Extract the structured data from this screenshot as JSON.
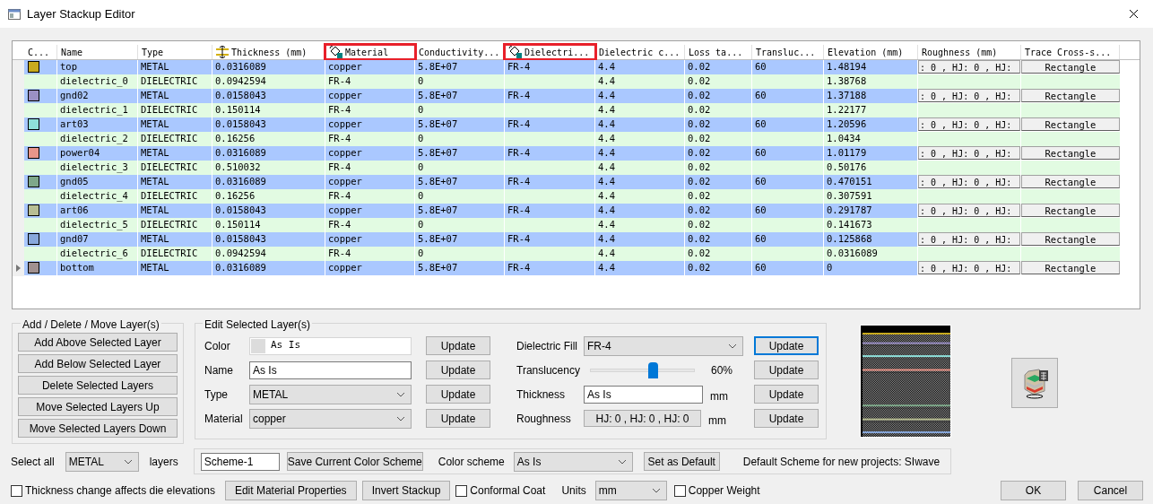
{
  "window": {
    "title": "Layer Stackup Editor"
  },
  "table": {
    "columns": [
      {
        "label": "C...",
        "highlighted": false
      },
      {
        "label": "Name",
        "highlighted": false
      },
      {
        "label": "Type",
        "highlighted": false
      },
      {
        "label": "Thickness (mm)",
        "highlighted": false
      },
      {
        "label": "Material",
        "highlighted": true
      },
      {
        "label": "Conductivity...",
        "highlighted": false
      },
      {
        "label": "Dielectri...",
        "highlighted": true
      },
      {
        "label": "Dielectric c...",
        "highlighted": false
      },
      {
        "label": "Loss ta...",
        "highlighted": false
      },
      {
        "label": "Transluc...",
        "highlighted": false
      },
      {
        "label": "Elevation (mm)",
        "highlighted": false
      },
      {
        "label": "Roughness (mm)",
        "highlighted": false
      },
      {
        "label": "Trace Cross-s...",
        "highlighted": false
      }
    ],
    "rows": [
      {
        "kind": "metal",
        "current": false,
        "color": "#c8aa1e",
        "name": "top",
        "type": "METAL",
        "thickness": "0.0316089",
        "material": "copper",
        "conductivity": "5.8E+07",
        "dielectric_fill": "FR-4",
        "dielectric_constant": "4.4",
        "loss_tangent": "0.02",
        "translucency": "60",
        "elevation": "1.48194",
        "roughness": ": 0 , HJ: 0 , HJ:",
        "trace_cross_section": "Rectangle"
      },
      {
        "kind": "dielectric",
        "current": false,
        "name": "dielectric_0",
        "type": "DIELECTRIC",
        "thickness": "0.0942594",
        "material": "FR-4",
        "conductivity": "0",
        "dielectric_constant": "4.4",
        "loss_tangent": "0.02",
        "elevation": "1.38768"
      },
      {
        "kind": "metal",
        "current": false,
        "color": "#9b90c4",
        "name": "gnd02",
        "type": "METAL",
        "thickness": "0.0158043",
        "material": "copper",
        "conductivity": "5.8E+07",
        "dielectric_fill": "FR-4",
        "dielectric_constant": "4.4",
        "loss_tangent": "0.02",
        "translucency": "60",
        "elevation": "1.37188",
        "roughness": ": 0 , HJ: 0 , HJ:",
        "trace_cross_section": "Rectangle"
      },
      {
        "kind": "dielectric",
        "current": false,
        "name": "dielectric_1",
        "type": "DIELECTRIC",
        "thickness": "0.150114",
        "material": "FR-4",
        "conductivity": "0",
        "dielectric_constant": "4.4",
        "loss_tangent": "0.02",
        "elevation": "1.22177"
      },
      {
        "kind": "metal",
        "current": false,
        "color": "#8ee0da",
        "name": "art03",
        "type": "METAL",
        "thickness": "0.0158043",
        "material": "copper",
        "conductivity": "5.8E+07",
        "dielectric_fill": "FR-4",
        "dielectric_constant": "4.4",
        "loss_tangent": "0.02",
        "translucency": "60",
        "elevation": "1.20596",
        "roughness": ": 0 , HJ: 0 , HJ:",
        "trace_cross_section": "Rectangle"
      },
      {
        "kind": "dielectric",
        "current": false,
        "name": "dielectric_2",
        "type": "DIELECTRIC",
        "thickness": "0.16256",
        "material": "FR-4",
        "conductivity": "0",
        "dielectric_constant": "4.4",
        "loss_tangent": "0.02",
        "elevation": "1.0434"
      },
      {
        "kind": "metal",
        "current": false,
        "color": "#e8968a",
        "name": "power04",
        "type": "METAL",
        "thickness": "0.0316089",
        "material": "copper",
        "conductivity": "5.8E+07",
        "dielectric_fill": "FR-4",
        "dielectric_constant": "4.4",
        "loss_tangent": "0.02",
        "translucency": "60",
        "elevation": "1.01179",
        "roughness": ": 0 , HJ: 0 , HJ:",
        "trace_cross_section": "Rectangle"
      },
      {
        "kind": "dielectric",
        "current": false,
        "name": "dielectric_3",
        "type": "DIELECTRIC",
        "thickness": "0.510032",
        "material": "FR-4",
        "conductivity": "0",
        "dielectric_constant": "4.4",
        "loss_tangent": "0.02",
        "elevation": "0.50176"
      },
      {
        "kind": "metal",
        "current": false,
        "color": "#7ea88a",
        "name": "gnd05",
        "type": "METAL",
        "thickness": "0.0316089",
        "material": "copper",
        "conductivity": "5.8E+07",
        "dielectric_fill": "FR-4",
        "dielectric_constant": "4.4",
        "loss_tangent": "0.02",
        "translucency": "60",
        "elevation": "0.470151",
        "roughness": ": 0 , HJ: 0 , HJ:",
        "trace_cross_section": "Rectangle"
      },
      {
        "kind": "dielectric",
        "current": false,
        "name": "dielectric_4",
        "type": "DIELECTRIC",
        "thickness": "0.16256",
        "material": "FR-4",
        "conductivity": "0",
        "dielectric_constant": "4.4",
        "loss_tangent": "0.02",
        "elevation": "0.307591"
      },
      {
        "kind": "metal",
        "current": false,
        "color": "#b8be94",
        "name": "art06",
        "type": "METAL",
        "thickness": "0.0158043",
        "material": "copper",
        "conductivity": "5.8E+07",
        "dielectric_fill": "FR-4",
        "dielectric_constant": "4.4",
        "loss_tangent": "0.02",
        "translucency": "60",
        "elevation": "0.291787",
        "roughness": ": 0 , HJ: 0 , HJ:",
        "trace_cross_section": "Rectangle"
      },
      {
        "kind": "dielectric",
        "current": false,
        "name": "dielectric_5",
        "type": "DIELECTRIC",
        "thickness": "0.150114",
        "material": "FR-4",
        "conductivity": "0",
        "dielectric_constant": "4.4",
        "loss_tangent": "0.02",
        "elevation": "0.141673"
      },
      {
        "kind": "metal",
        "current": false,
        "color": "#88a8dc",
        "name": "gnd07",
        "type": "METAL",
        "thickness": "0.0158043",
        "material": "copper",
        "conductivity": "5.8E+07",
        "dielectric_fill": "FR-4",
        "dielectric_constant": "4.4",
        "loss_tangent": "0.02",
        "translucency": "60",
        "elevation": "0.125868",
        "roughness": ": 0 , HJ: 0 , HJ:",
        "trace_cross_section": "Rectangle"
      },
      {
        "kind": "dielectric",
        "current": false,
        "name": "dielectric_6",
        "type": "DIELECTRIC",
        "thickness": "0.0942594",
        "material": "FR-4",
        "conductivity": "0",
        "dielectric_constant": "4.4",
        "loss_tangent": "0.02",
        "elevation": "0.0316089"
      },
      {
        "kind": "metal",
        "current": true,
        "color": "#a09090",
        "name": "bottom",
        "type": "METAL",
        "thickness": "0.0316089",
        "material": "copper",
        "conductivity": "5.8E+07",
        "dielectric_fill": "FR-4",
        "dielectric_constant": "4.4",
        "loss_tangent": "0.02",
        "translucency": "60",
        "elevation": "0",
        "roughness": ": 0 , HJ: 0 , HJ:",
        "trace_cross_section": "Rectangle"
      }
    ]
  },
  "layer_group": {
    "title": "Add / Delete / Move Layer(s)",
    "buttons": [
      "Add Above Selected Layer",
      "Add Below Selected Layer",
      "Delete Selected Layers",
      "Move Selected Layers Up",
      "Move Selected Layers Down"
    ]
  },
  "edit_group": {
    "title": "Edit Selected Layer(s)",
    "left_fields": [
      {
        "kind": "color",
        "label": "Color",
        "value": "As Is",
        "button": "Update",
        "button_focused": false
      },
      {
        "kind": "text",
        "label": "Name",
        "value": "As Is",
        "button": "Update",
        "button_focused": false
      },
      {
        "kind": "dropdown",
        "label": "Type",
        "value": "METAL",
        "button": "Update",
        "button_focused": false
      },
      {
        "kind": "dropdown",
        "label": "Material",
        "value": "copper",
        "button": "Update",
        "button_focused": false
      }
    ],
    "right_fields": [
      {
        "kind": "dropdown",
        "label": "Dielectric Fill",
        "value": "FR-4",
        "button": "Update",
        "button_focused": true
      },
      {
        "kind": "slider",
        "label": "Translucency",
        "level": 0.6,
        "reading": "60%",
        "button": "Update",
        "button_focused": false
      },
      {
        "kind": "text",
        "label": "Thickness",
        "value": "As Is",
        "unit": "mm",
        "button": "Update",
        "button_focused": false
      },
      {
        "kind": "button",
        "label": "Roughness",
        "value": "HJ: 0 , HJ: 0 , HJ: 0",
        "unit": "mm",
        "button": "Update",
        "button_focused": false
      }
    ]
  },
  "select_all": {
    "label": "Select all",
    "value": "METAL",
    "suffix": "layers"
  },
  "scheme": {
    "name": "Scheme-1",
    "save_button": "Save Current Color Scheme",
    "label": "Color scheme",
    "value": "As Is",
    "default_button": "Set as Default",
    "note": "Default Scheme for new projects: SIwave"
  },
  "options": [
    {
      "kind": "checkbox",
      "label": "Thickness change affects die elevations",
      "checked": false
    },
    {
      "kind": "button",
      "label": "Edit Material Properties"
    },
    {
      "kind": "button",
      "label": "Invert Stackup"
    },
    {
      "kind": "checkbox",
      "label": "Conformal Coat",
      "checked": false
    },
    {
      "kind": "dropdown",
      "label": "Units",
      "value": "mm"
    },
    {
      "kind": "checkbox",
      "label": "Copper Weight",
      "checked": false
    }
  ],
  "dialog_buttons": [
    "OK",
    "Cancel"
  ]
}
